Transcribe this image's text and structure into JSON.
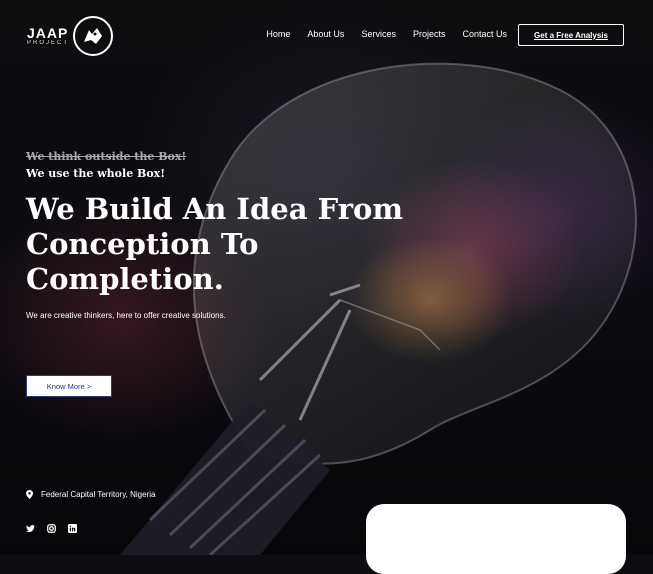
{
  "brand": {
    "name": "JAAP",
    "sub": "PROJECT"
  },
  "nav": [
    {
      "label": "Home"
    },
    {
      "label": "About Us"
    },
    {
      "label": "Services"
    },
    {
      "label": "Projects"
    },
    {
      "label": "Contact Us"
    }
  ],
  "cta_label": "Get a Free Analysis",
  "hero": {
    "struck": "We think outside the Box!",
    "tagline": "We use the whole Box!",
    "headline_1": "We Build An Idea From",
    "headline_2": "Conception To",
    "headline_3": "Completion.",
    "sub": "We are creative thinkers, here to offer creative solutions.",
    "button": "Know More >"
  },
  "location": "Federal Capital Territory, Nigeria",
  "socials": [
    "twitter-icon",
    "instagram-icon",
    "linkedin-icon"
  ]
}
